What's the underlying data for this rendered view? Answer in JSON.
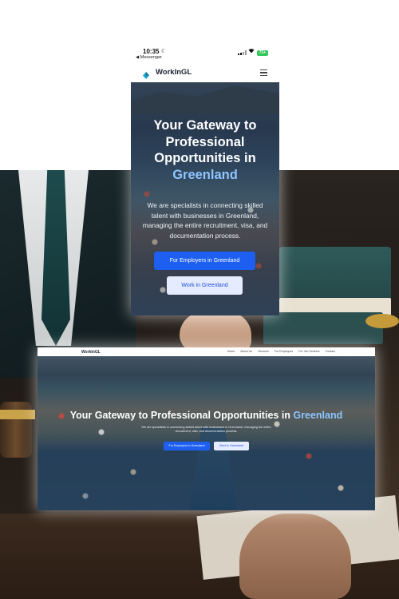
{
  "mobile": {
    "status_bar": {
      "time": "10:35",
      "back_label": "◀ Messenger",
      "battery": "71+"
    },
    "nav": {
      "brand": "WorkInGL"
    },
    "hero": {
      "title_main": "Your Gateway to Professional Opportunities in",
      "title_highlight": "Greenland",
      "description": "We are specialists in connecting skilled talent with businesses in Greenland, managing the entire recruitment, visa, and documentation process.",
      "primary_button": "For Employers in Greenland",
      "secondary_button": "Work in Greenland"
    }
  },
  "desktop": {
    "nav": {
      "brand": "WorkInGL",
      "menu": [
        "Home",
        "About Us",
        "Services",
        "For Employers",
        "For Job Seekers",
        "Contact"
      ]
    },
    "hero": {
      "title_main": "Your Gateway to Professional Opportunities in",
      "title_highlight": "Greenland",
      "description": "We are specialists in connecting skilled talent with businesses in Greenland, managing the entire recruitment, visa, and documentation process.",
      "primary_button": "For Employers in Greenland",
      "secondary_button": "Work in Greenland"
    }
  },
  "colors": {
    "accent": "#1d5ff0",
    "highlight": "#8ec5ff",
    "brand_icon": "#1aa3c8"
  },
  "icons": [
    "moon-icon",
    "signal-icon",
    "wifi-icon",
    "battery-icon",
    "logo-icon",
    "hamburger-icon"
  ]
}
